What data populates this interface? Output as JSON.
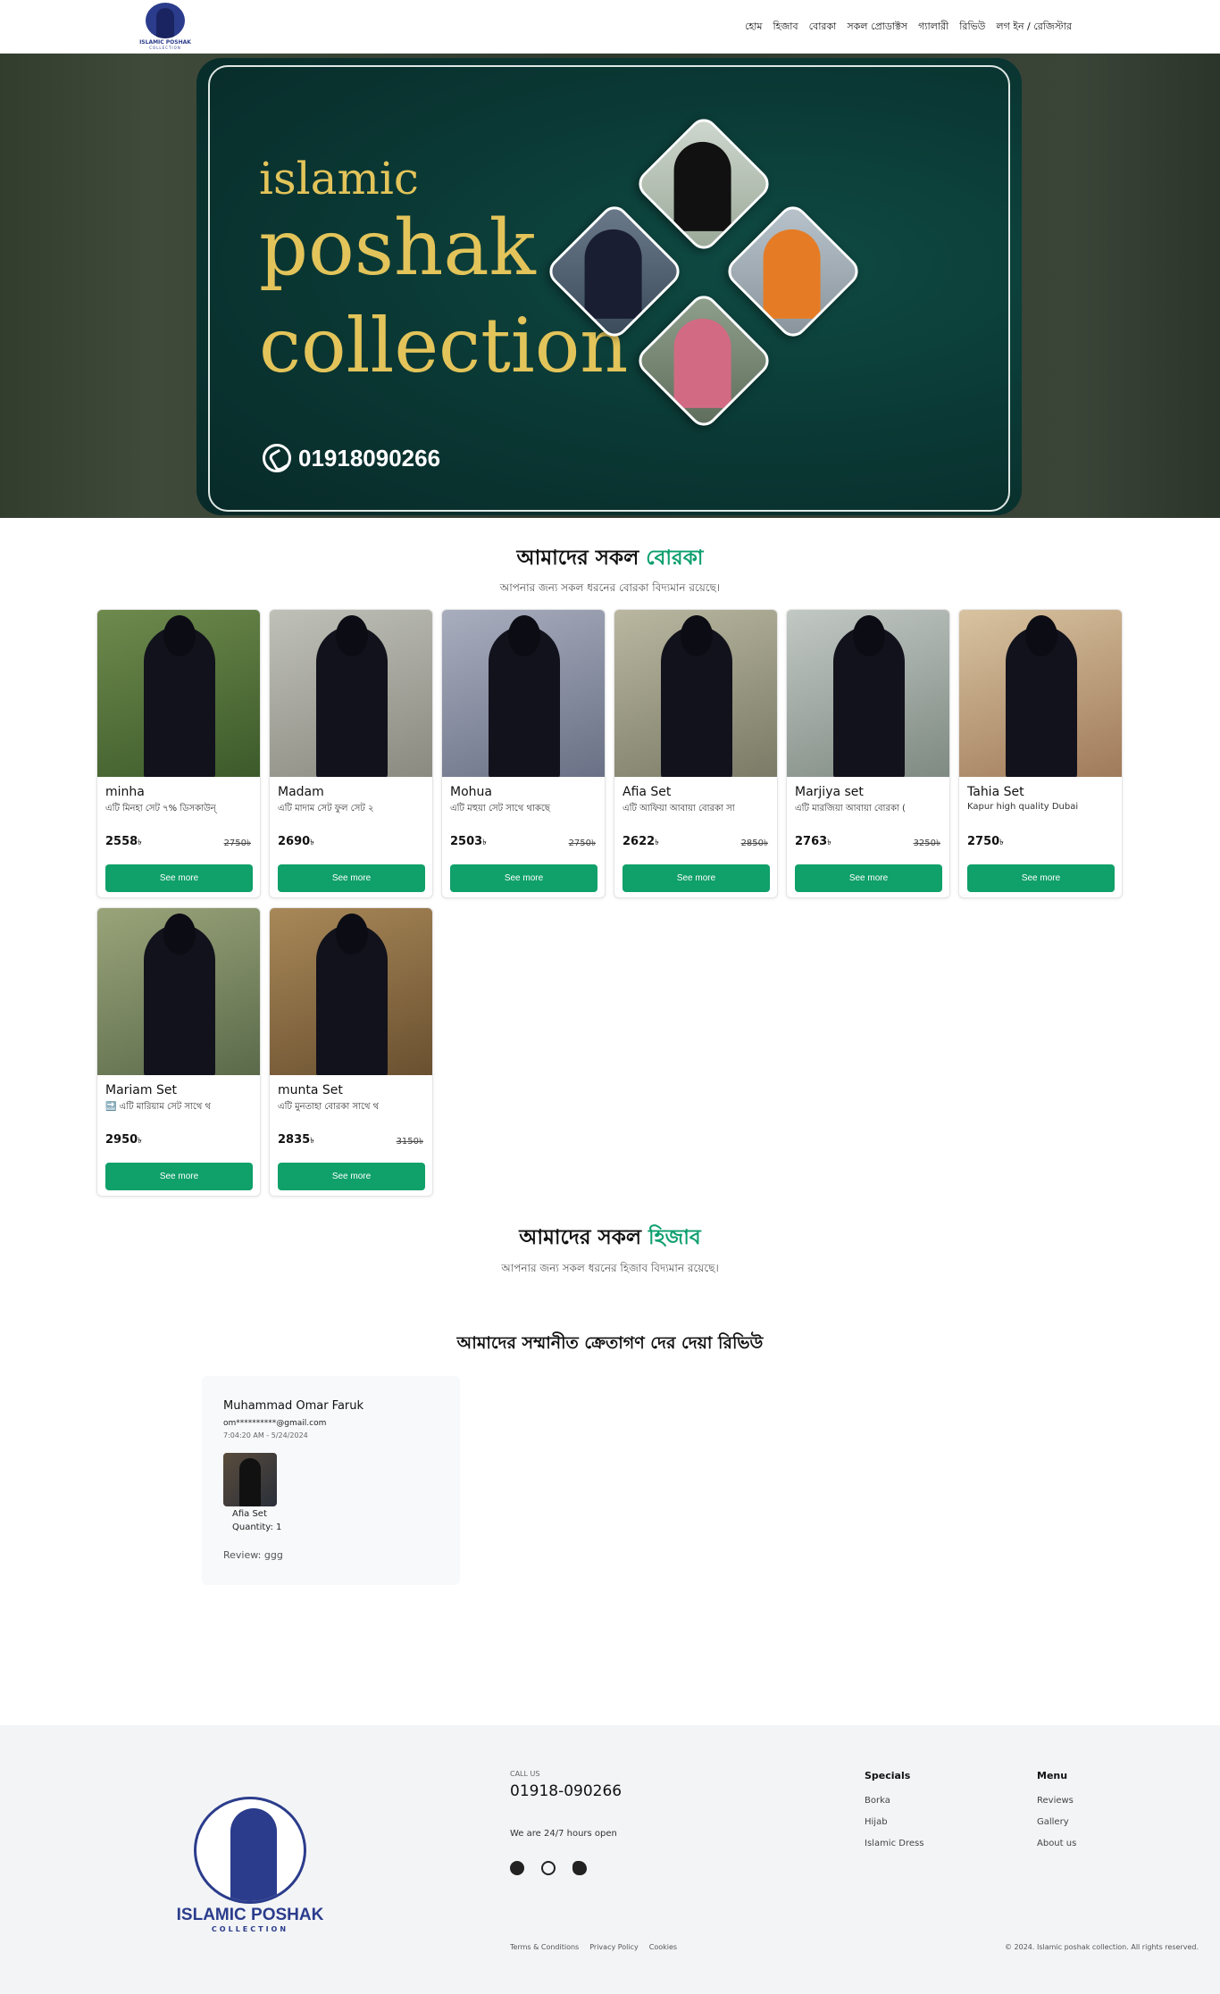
{
  "brand": {
    "logo_text": "ISLAMIC POSHAK",
    "logo_sub": "COLLECTION"
  },
  "nav": {
    "items": [
      "হোম",
      "হিজাব",
      "বোরকা",
      "সকল প্রোডাক্টস",
      "গ্যালারী",
      "রিভিউ",
      "লগ ইন / রেজিস্টার"
    ]
  },
  "hero": {
    "line1": "islamic",
    "line2": "poshak",
    "line3": "collection",
    "phone": "01918090266"
  },
  "borka_section": {
    "title": "আমাদের সকল",
    "title_accent": "বোরকা",
    "subtitle": "আপনার জন্য সকল ধরনের বোরকা বিদ্যমান রয়েছে।"
  },
  "products": [
    {
      "name": "minha",
      "desc": "এটি মিনহা সেট ৭% ডিসকাউন্",
      "price": "2558",
      "old_price": "2750",
      "bg1": "#3c5a2a",
      "bg2": "#6e8a4d"
    },
    {
      "name": "Madam",
      "desc": "এটি মাদাম সেট ফুল সেট ২",
      "price": "2690",
      "old_price": "",
      "bg1": "#8a8a80",
      "bg2": "#bfc0b8"
    },
    {
      "name": "Mohua",
      "desc": "এটি মহুয়া সেট সাথে থাকছে",
      "price": "2503",
      "old_price": "2750",
      "bg1": "#6a7085",
      "bg2": "#a8aebe"
    },
    {
      "name": "Afia Set",
      "desc": "এটি আফিয়া আবায়া বোরকা সা",
      "price": "2622",
      "old_price": "2850",
      "bg1": "#7a7a66",
      "bg2": "#b9b7a0"
    },
    {
      "name": "Marjiya set",
      "desc": "এটি মারজিয়া আবায়া বোরকা (",
      "price": "2763",
      "old_price": "3250",
      "bg1": "#7e8a82",
      "bg2": "#c2c8c4"
    },
    {
      "name": "Tahia Set",
      "desc": "Kapur high quality Dubai",
      "price": "2750",
      "old_price": "",
      "bg1": "#a07a5a",
      "bg2": "#d8c3a0"
    },
    {
      "name": "Mariam Set",
      "desc": "🔜 এটি মারিয়াম সেট সাথে থ",
      "price": "2950",
      "old_price": "",
      "bg1": "#5a6a4a",
      "bg2": "#9aa47a"
    },
    {
      "name": "munta Set",
      "desc": "এটি মুনতাহা বোরকা সাথে থ",
      "price": "2835",
      "old_price": "3150",
      "bg1": "#6a5030",
      "bg2": "#a88858"
    }
  ],
  "currency": "৳",
  "see_more_label": "See more",
  "hijab_section": {
    "title": "আমাদের সকল",
    "title_accent": "হিজাব",
    "subtitle": "আপনার জন্য সকল ধরনের হিজাব বিদ্যমান রয়েছে।"
  },
  "reviews": {
    "title": "আমাদের সম্মানীত ক্রেতাগণ দের দেয়া রিভিউ",
    "items": [
      {
        "name": "Muhammad Omar Faruk",
        "email": "om**********@gmail.com",
        "time": "7:04:20 AM - 5/24/2024",
        "product": "Afia Set",
        "quantity": "Quantity: 1",
        "review": "Review: ggg"
      }
    ]
  },
  "footer": {
    "call_us": "CALL US",
    "phone": "01918-090266",
    "hours": "We are 24/7 hours open",
    "specials_title": "Specials",
    "specials": [
      "Borka",
      "Hijab",
      "Islamic Dress"
    ],
    "menu_title": "Menu",
    "menu": [
      "Reviews",
      "Gallery",
      "About us"
    ],
    "legal": [
      "Terms & Conditions",
      "Privacy Policy",
      "Cookies"
    ],
    "copyright": "© 2024. Islamic poshak collection. All rights reserved.",
    "logo_text": "ISLAMIC POSHAK",
    "logo_sub": "COLLECTION",
    "social_icons": [
      "facebook-icon",
      "whatsapp-icon",
      "twitter-icon"
    ]
  },
  "colors": {
    "accent": "#10a06a",
    "brand_blue": "#2b3c8c",
    "hero_gold": "#e3c45a"
  }
}
